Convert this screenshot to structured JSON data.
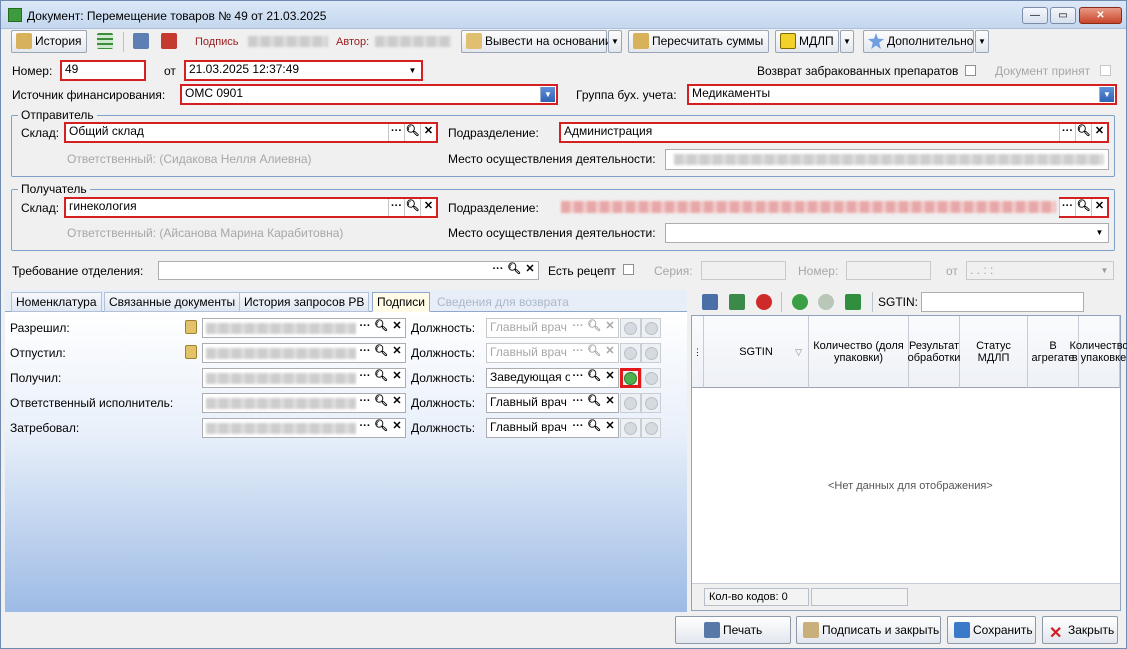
{
  "window": {
    "title": "Документ: Перемещение товаров № 49 от 21.03.2025"
  },
  "toolbar": {
    "history": "История",
    "signature": "Подпись",
    "author": "Автор:",
    "create_basis": "Вывести на основании",
    "recalc": "Пересчитать суммы",
    "mdlp": "МДЛП",
    "more": "Дополнительно"
  },
  "header": {
    "number_label": "Номер:",
    "number_value": "49",
    "from_label": "от",
    "date_value": "21.03.2025 12:37:49",
    "return_rejected_label": "Возврат забракованных препаратов",
    "doc_accepted_label": "Документ принят",
    "source_label": "Источник финансирования:",
    "source_value": "ОМС 0901",
    "acc_group_label": "Группа бух. учета:",
    "acc_group_value": "Медикаменты"
  },
  "sender": {
    "title": "Отправитель",
    "warehouse_label": "Склад:",
    "warehouse_value": "Общий склад",
    "responsible": "Ответственный: (Сидакова Нелля Алиевна)",
    "dept_label": "Подразделение:",
    "dept_value": "Администрация",
    "place_label": "Место осуществления деятельности:"
  },
  "receiver": {
    "title": "Получатель",
    "warehouse_label": "Склад:",
    "warehouse_value": "гинекология",
    "responsible": "Ответственный: (Айсанова Марина Карабитовна)",
    "dept_label": "Подразделение:",
    "place_label": "Место осуществления деятельности:"
  },
  "request": {
    "label": "Требование отделения:",
    "recipe_label": "Есть рецепт",
    "series_label": "Серия:",
    "number_label": "Номер:",
    "from_label": "от",
    "date_placeholder": " .  .      :  :"
  },
  "tabs": [
    "Номенклатура",
    "Связанные документы",
    "История запросов РВ",
    "Подписи",
    "Сведения для возврата"
  ],
  "signatures": {
    "position_label": "Должность:",
    "rows": [
      {
        "label": "Разрешил:",
        "position": "Главный врач"
      },
      {
        "label": "Отпустил:",
        "position": "Главный врач"
      },
      {
        "label": "Получил:",
        "position": "Заведующая от"
      },
      {
        "label": "Ответственный исполнитель:",
        "position": "Главный врач"
      },
      {
        "label": "Затребовал:",
        "position": "Главный врач"
      }
    ]
  },
  "sgtin": {
    "label": "SGTIN:",
    "columns": [
      "SGTIN",
      "Количество (доля упаковки)",
      "Результат обработки",
      "Статус МДЛП",
      "В агрегате",
      "Количество в упаковке"
    ],
    "empty": "<Нет данных для отображения>",
    "count_label": "Кол-во кодов: 0"
  },
  "footer": {
    "print": "Печать",
    "sign_close": "Подписать и закрыть",
    "save": "Сохранить",
    "close": "Закрыть"
  }
}
